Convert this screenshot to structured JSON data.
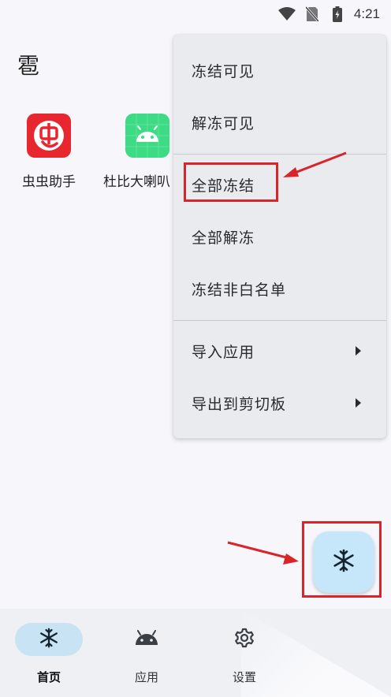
{
  "status_bar": {
    "time": "4:21",
    "icons": [
      "wifi-icon",
      "no-sim-icon",
      "battery-charging-icon"
    ]
  },
  "page": {
    "title": "雹"
  },
  "apps": [
    {
      "label": "虫虫助手",
      "icon": "chongchong-app-icon",
      "color": "#e8262f"
    },
    {
      "label": "杜比大喇叭",
      "icon": "android-app-icon",
      "color": "#3ddc84"
    }
  ],
  "menu": {
    "items": [
      {
        "label": "冻结可见"
      },
      {
        "label": "解冻可见"
      },
      {
        "label": "全部冻结"
      },
      {
        "label": "全部解冻"
      },
      {
        "label": "冻结非白名单"
      },
      {
        "label": "导入应用",
        "has_submenu": true
      },
      {
        "label": "导出到剪切板",
        "has_submenu": true
      }
    ]
  },
  "fab": {
    "icon": "snowflake-icon"
  },
  "bottom_nav": {
    "items": [
      {
        "label": "首页",
        "icon": "snowflake-icon",
        "active": true
      },
      {
        "label": "应用",
        "icon": "android-icon",
        "active": false
      },
      {
        "label": "设置",
        "icon": "gear-icon",
        "active": false
      }
    ]
  },
  "colors": {
    "accent": "#c6e7fa",
    "annotation": "#d9252a",
    "menu_bg": "#e9ebef"
  }
}
